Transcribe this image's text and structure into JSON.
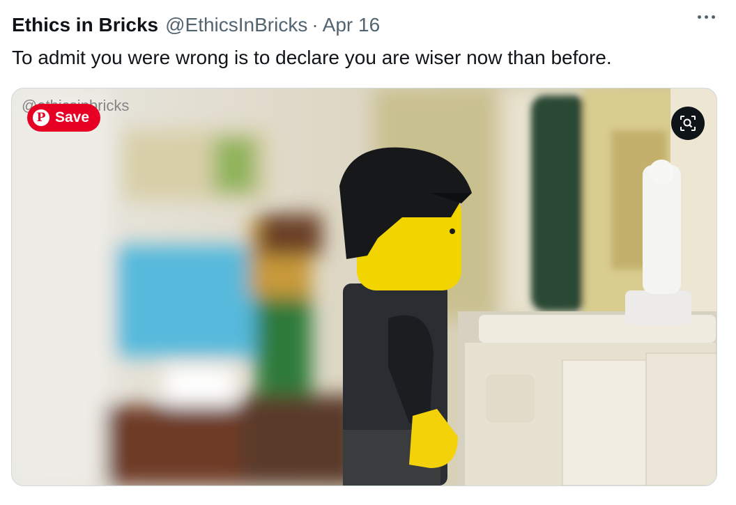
{
  "tweet": {
    "author_name": "Ethics in Bricks",
    "author_handle": "@EthicsInBricks",
    "separator": "·",
    "date": "Apr 16",
    "text": "To admit you were wrong is to declare you are wiser now than before."
  },
  "media": {
    "watermark": "@ethicsinbricks",
    "pinterest_save_label": "Save",
    "pinterest_icon": "pinterest-icon",
    "zoom_icon": "search-zoom-icon",
    "more_icon": "more-options-icon",
    "colors": {
      "pinterest_red": "#e60023",
      "zoom_bg": "#0f1419"
    }
  }
}
